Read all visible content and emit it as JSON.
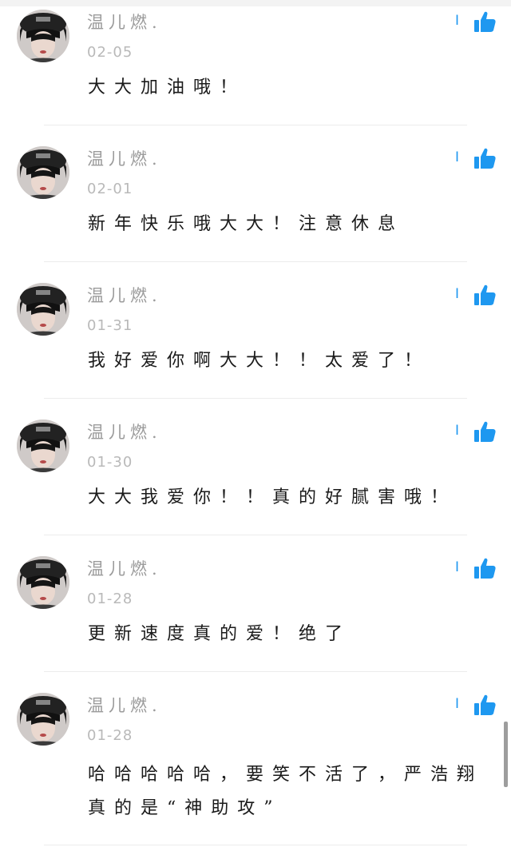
{
  "comments": [
    {
      "username": "温儿燃.",
      "date": "02-05",
      "text": "大大加油哦！",
      "like_count": "I",
      "like_icon": "thumbs-up-icon"
    },
    {
      "username": "温儿燃.",
      "date": "02-01",
      "text": "新年快乐哦大大！注意休息",
      "like_count": "I",
      "like_icon": "thumbs-up-icon"
    },
    {
      "username": "温儿燃.",
      "date": "01-31",
      "text": "我好爱你啊大大！！太爱了！",
      "like_count": "I",
      "like_icon": "thumbs-up-icon"
    },
    {
      "username": "温儿燃.",
      "date": "01-30",
      "text": "大大我爱你！！真的好腻害哦！",
      "like_count": "I",
      "like_icon": "thumbs-up-icon"
    },
    {
      "username": "温儿燃.",
      "date": "01-28",
      "text": "更新速度真的爱！绝了",
      "like_count": "I",
      "like_icon": "thumbs-up-icon"
    },
    {
      "username": "温儿燃.",
      "date": "01-28",
      "text": "哈哈哈哈哈，要笑不活了，严浩翔真的是“神助攻”",
      "like_count": "I",
      "like_icon": "thumbs-up-icon"
    }
  ],
  "colors": {
    "accent": "#1e98f0",
    "username": "#9b9b9b",
    "date": "#b9b9b9",
    "text": "#1a1a1a"
  }
}
